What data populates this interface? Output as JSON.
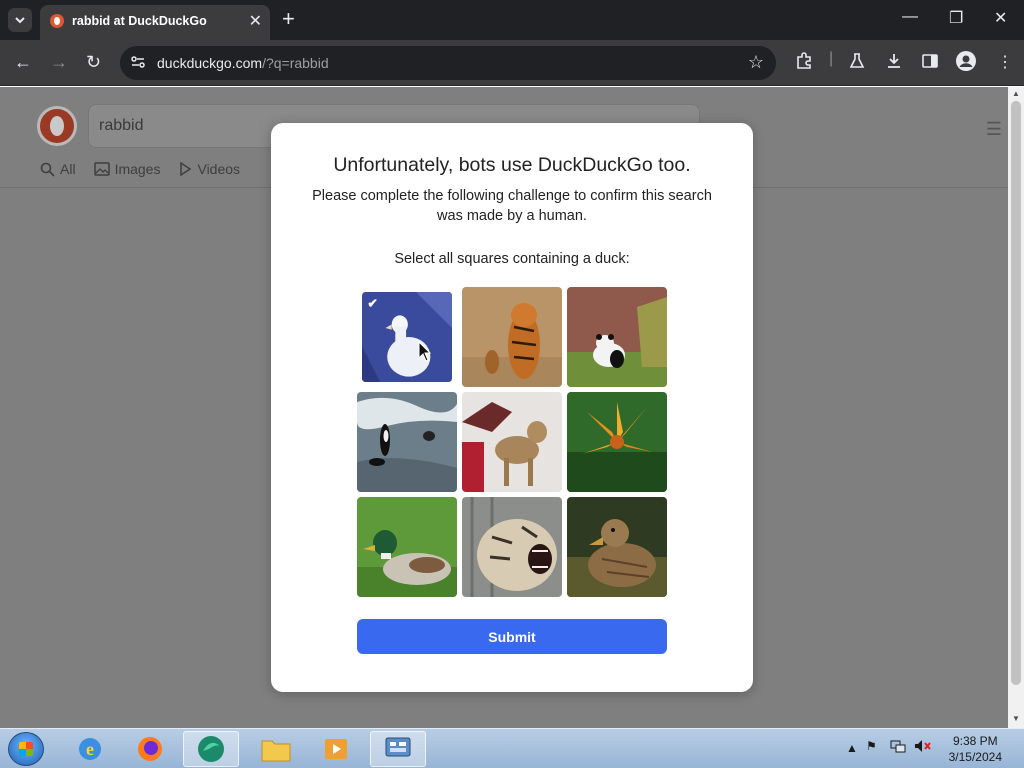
{
  "browser": {
    "tab_title": "rabbid at DuckDuckGo",
    "url_host": "duckduckgo.com",
    "url_rest": "/?q=rabbid"
  },
  "page": {
    "search_value": "rabbid",
    "tabs": [
      {
        "label": "All",
        "icon": "search-icon"
      },
      {
        "label": "Images",
        "icon": "image-icon"
      },
      {
        "label": "Videos",
        "icon": "play-icon"
      }
    ]
  },
  "modal": {
    "title": "Unfortunately, bots use DuckDuckGo too.",
    "subtitle": "Please complete the following challenge to confirm this search was made by a human.",
    "prompt": "Select all squares containing a duck:",
    "tiles": [
      {
        "content": "white duck",
        "selected": true
      },
      {
        "content": "tiger and cub",
        "selected": false
      },
      {
        "content": "panda",
        "selected": false
      },
      {
        "content": "orcas",
        "selected": false
      },
      {
        "content": "cat",
        "selected": false
      },
      {
        "content": "orange lily",
        "selected": false
      },
      {
        "content": "mallard duck",
        "selected": false
      },
      {
        "content": "white tiger",
        "selected": false
      },
      {
        "content": "female mallard",
        "selected": false
      }
    ],
    "submit_label": "Submit"
  },
  "taskbar": {
    "time": "9:38 PM",
    "date": "3/15/2024"
  }
}
